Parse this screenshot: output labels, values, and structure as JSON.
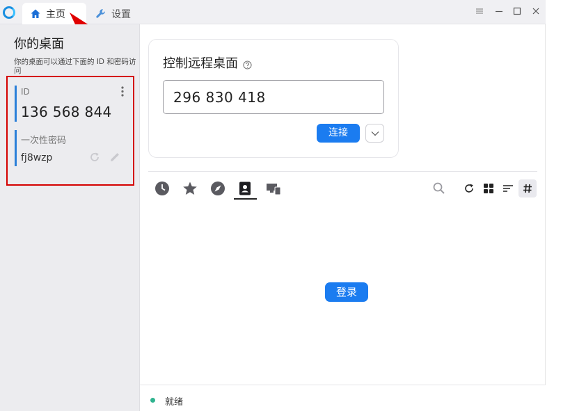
{
  "titlebar": {
    "tabs": [
      {
        "label": "主页",
        "icon": "home-icon",
        "active": true
      },
      {
        "label": "设置",
        "icon": "wrench-icon",
        "active": false
      }
    ],
    "controls": [
      "menu-icon",
      "minimize-icon",
      "maximize-icon",
      "close-icon"
    ]
  },
  "left": {
    "title": "你的桌面",
    "description": "你的桌面可以通过下面的 ID 和密码访问",
    "id_label": "ID",
    "id_value": "136 568 844",
    "password_label": "一次性密码",
    "password_value": "fj8wzp"
  },
  "connect": {
    "title": "控制远程桌面",
    "remote_id_value": "296 830 418",
    "connect_label": "连接"
  },
  "peer_tabs": [
    "recent-sessions-icon",
    "favorites-icon",
    "discovered-icon",
    "address-book-icon",
    "lan-devices-icon"
  ],
  "toolbar": [
    "search-icon",
    "refresh-icon",
    "grid-view-icon",
    "sort-icon",
    "hash-icon"
  ],
  "main": {
    "login_label": "登录"
  },
  "status": {
    "text": "就绪",
    "color": "#2fb38f"
  },
  "colors": {
    "accent": "#1b7cf0",
    "highlight_box": "#d40000"
  }
}
